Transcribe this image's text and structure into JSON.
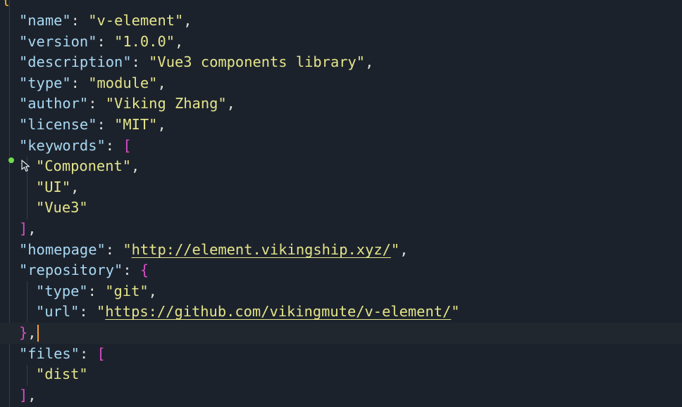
{
  "editor": {
    "top_brace": "{",
    "lines": [
      {
        "key": "\"name\"",
        "value": "\"v-element\"",
        "trail": ","
      },
      {
        "key": "\"version\"",
        "value": "\"1.0.0\"",
        "trail": ","
      },
      {
        "key": "\"description\"",
        "value": "\"Vue3 components library\"",
        "trail": ","
      },
      {
        "key": "\"type\"",
        "value": "\"module\"",
        "trail": ","
      },
      {
        "key": "\"author\"",
        "value": "\"Viking Zhang\"",
        "trail": ","
      },
      {
        "key": "\"license\"",
        "value": "\"MIT\"",
        "trail": ","
      },
      {
        "key": "\"keywords\"",
        "open": "["
      },
      {
        "item": "\"Component\"",
        "trail": ","
      },
      {
        "item": "\"UI\"",
        "trail": ","
      },
      {
        "item": "\"Vue3\""
      },
      {
        "close": "]",
        "trail": ","
      },
      {
        "key": "\"homepage\"",
        "q1": "\"",
        "url": "http://element.vikingship.xyz/",
        "q2": "\"",
        "trail": ","
      },
      {
        "key": "\"repository\"",
        "open": "{"
      },
      {
        "key": "\"type\"",
        "value": "\"git\"",
        "trail": ","
      },
      {
        "key": "\"url\"",
        "q1": "\"",
        "url": "https://github.com/vikingmute/v-element/",
        "q2": "\""
      },
      {
        "close": "}",
        "trail": ","
      },
      {
        "key": "\"files\"",
        "open": "["
      },
      {
        "item": "\"dist\""
      },
      {
        "close": "]",
        "trail": ","
      }
    ],
    "colon": ": "
  },
  "colors": {
    "background": "#1c222c",
    "key": "#a8d8f2",
    "string": "#e4e48a",
    "bracket": "#d64fc6",
    "top_brace": "#f2b430",
    "caret": "#f2a23a",
    "change_marker": "#6fdc4a"
  },
  "icons": [
    "mouse-pointer-icon",
    "change-marker-dot"
  ]
}
